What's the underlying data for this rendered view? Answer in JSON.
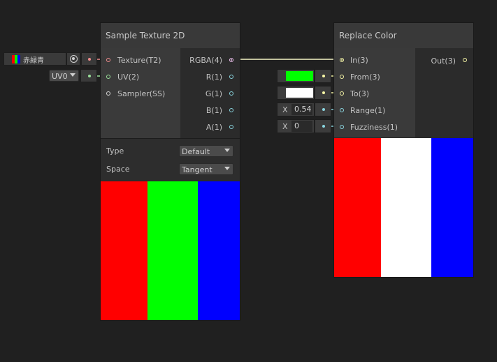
{
  "colors": {
    "red": "#ff0000",
    "green": "#00ff00",
    "blue": "#0000ff",
    "white": "#ffffff",
    "port_texture": "#f08c8c",
    "port_vector2": "#9ae09a",
    "port_vector3": "#f6f6a6",
    "port_vector1": "#8ad6e0",
    "port_vector4": "#f0c2f0"
  },
  "texture_input": {
    "name": "赤緑青",
    "icon": "texture-thumbnail-icon",
    "picker_icon": "object-picker-icon"
  },
  "uv_input": {
    "value": "UV0"
  },
  "sample_node": {
    "title": "Sample Texture 2D",
    "inputs": [
      {
        "label": "Texture(T2)"
      },
      {
        "label": "UV(2)"
      },
      {
        "label": "Sampler(SS)"
      }
    ],
    "outputs": [
      {
        "label": "RGBA(4)"
      },
      {
        "label": "R(1)"
      },
      {
        "label": "G(1)"
      },
      {
        "label": "B(1)"
      },
      {
        "label": "A(1)"
      }
    ],
    "type_label": "Type",
    "type_value": "Default",
    "space_label": "Space",
    "space_value": "Tangent",
    "preview_colors": [
      "#ff0000",
      "#00ff00",
      "#0000ff"
    ]
  },
  "replace_node": {
    "title": "Replace Color",
    "inputs": [
      {
        "label": "In(3)"
      },
      {
        "label": "From(3)"
      },
      {
        "label": "To(3)"
      },
      {
        "label": "Range(1)"
      },
      {
        "label": "Fuzziness(1)"
      }
    ],
    "outputs": [
      {
        "label": "Out(3)"
      }
    ],
    "preview_colors": [
      "#ff0000",
      "#ffffff",
      "#0000ff"
    ]
  },
  "from_color": "#00ff00",
  "to_color": "#ffffff",
  "range_field": {
    "axis": "X",
    "value": "0.54"
  },
  "fuzziness_field": {
    "axis": "X",
    "value": "0"
  }
}
